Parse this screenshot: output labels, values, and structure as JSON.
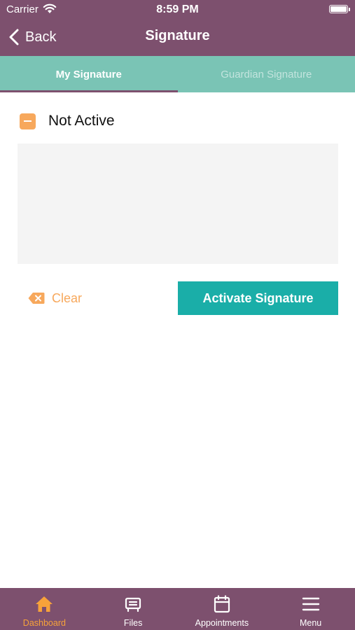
{
  "status_bar": {
    "carrier": "Carrier",
    "time": "8:59 PM"
  },
  "nav": {
    "back_label": "Back",
    "title": "Signature"
  },
  "tabs": [
    {
      "label": "My Signature",
      "active": true
    },
    {
      "label": "Guardian Signature",
      "active": false
    }
  ],
  "signature": {
    "status_label": "Not Active"
  },
  "actions": {
    "clear_label": "Clear",
    "activate_label": "Activate Signature"
  },
  "tabbar": {
    "items": [
      {
        "label": "Dashboard",
        "icon": "home-icon",
        "active": true
      },
      {
        "label": "Files",
        "icon": "files-icon",
        "active": false
      },
      {
        "label": "Appointments",
        "icon": "calendar-icon",
        "active": false
      },
      {
        "label": "Menu",
        "icon": "menu-icon",
        "active": false
      }
    ]
  },
  "colors": {
    "header": "#7d506e",
    "tabs_bg": "#7ac4b5",
    "accent_orange": "#f7a85c",
    "active_tab_orange": "#f7a23a",
    "button_teal": "#1aaea8",
    "pad_bg": "#f4f4f4"
  }
}
